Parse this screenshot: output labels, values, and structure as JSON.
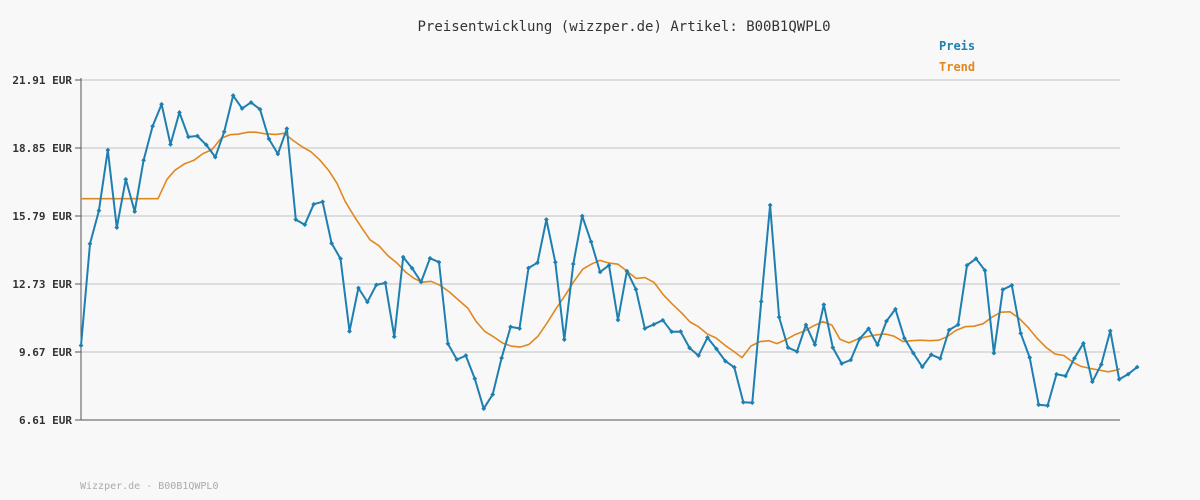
{
  "chart_data": {
    "type": "line",
    "title": "Preisentwicklung (wizzper.de) Artikel: B00B1QWPL0",
    "ylabel": "",
    "xlabel": "",
    "ylim": [
      6.61,
      21.91
    ],
    "yticks": [
      "21.91 EUR",
      "18.85 EUR",
      "15.79 EUR",
      "12.73 EUR",
      "9.67 EUR",
      "6.61 EUR"
    ],
    "ytick_values": [
      21.91,
      18.85,
      15.79,
      12.73,
      9.67,
      6.61
    ],
    "grid": true,
    "legend_position": "top-right",
    "series": [
      {
        "name": "Preis",
        "color": "#1e7fb0",
        "marker": "diamond",
        "values": [
          9.96,
          14.54,
          16.03,
          18.76,
          15.27,
          17.44,
          15.99,
          18.3,
          19.83,
          20.82,
          19.01,
          20.45,
          19.35,
          19.39,
          18.99,
          18.44,
          19.58,
          21.21,
          20.63,
          20.9,
          20.59,
          19.26,
          18.58,
          19.72,
          15.63,
          15.4,
          16.32,
          16.43,
          14.56,
          13.87,
          10.6,
          12.55,
          11.92,
          12.69,
          12.78,
          10.36,
          13.94,
          13.44,
          12.82,
          13.89,
          13.71,
          10.04,
          9.33,
          9.51,
          8.47,
          7.12,
          7.76,
          9.4,
          10.8,
          10.73,
          13.45,
          13.69,
          15.63,
          13.71,
          10.23,
          13.63,
          15.79,
          14.63,
          13.27,
          13.57,
          11.11,
          13.31,
          12.49,
          10.73,
          10.91,
          11.1,
          10.58,
          10.59,
          9.85,
          9.51,
          10.32,
          9.81,
          9.26,
          8.98,
          7.41,
          7.39,
          11.94,
          16.28,
          11.24,
          9.87,
          9.69,
          10.89,
          10.0,
          11.8,
          9.87,
          9.15,
          9.31,
          10.26,
          10.72,
          9.99,
          11.06,
          11.6,
          10.29,
          9.62,
          9.0,
          9.55,
          9.38,
          10.66,
          10.9,
          13.57,
          13.87,
          13.34,
          9.62,
          12.48,
          12.67,
          10.51,
          9.42,
          7.3,
          7.26,
          8.67,
          8.59,
          9.39,
          10.06,
          8.33,
          9.11,
          10.62,
          8.44,
          8.67,
          8.99
        ],
        "x_start": 81,
        "x_step": 8.95
      },
      {
        "name": "Trend",
        "color": "#e08820",
        "points": [
          [
            81,
            16.57
          ],
          [
            158,
            16.57
          ],
          [
            167,
            17.44
          ],
          [
            175,
            17.85
          ],
          [
            185,
            18.15
          ],
          [
            194,
            18.3
          ],
          [
            203,
            18.6
          ],
          [
            212,
            18.78
          ],
          [
            221,
            19.28
          ],
          [
            230,
            19.45
          ],
          [
            238,
            19.47
          ],
          [
            248,
            19.56
          ],
          [
            256,
            19.56
          ],
          [
            265,
            19.49
          ],
          [
            276,
            19.46
          ],
          [
            284,
            19.51
          ],
          [
            293,
            19.19
          ],
          [
            302,
            18.91
          ],
          [
            311,
            18.68
          ],
          [
            320,
            18.3
          ],
          [
            329,
            17.82
          ],
          [
            337,
            17.26
          ],
          [
            345,
            16.46
          ],
          [
            354,
            15.79
          ],
          [
            362,
            15.24
          ],
          [
            370,
            14.72
          ],
          [
            379,
            14.45
          ],
          [
            388,
            14.0
          ],
          [
            397,
            13.67
          ],
          [
            406,
            13.25
          ],
          [
            414,
            12.98
          ],
          [
            422,
            12.81
          ],
          [
            431,
            12.85
          ],
          [
            440,
            12.67
          ],
          [
            449,
            12.39
          ],
          [
            458,
            12.03
          ],
          [
            468,
            11.63
          ],
          [
            476,
            11.05
          ],
          [
            485,
            10.59
          ],
          [
            494,
            10.34
          ],
          [
            503,
            10.06
          ],
          [
            512,
            9.93
          ],
          [
            520,
            9.89
          ],
          [
            529,
            10.01
          ],
          [
            538,
            10.38
          ],
          [
            547,
            10.97
          ],
          [
            556,
            11.62
          ],
          [
            565,
            12.21
          ],
          [
            574,
            12.85
          ],
          [
            583,
            13.41
          ],
          [
            592,
            13.64
          ],
          [
            600,
            13.79
          ],
          [
            609,
            13.67
          ],
          [
            618,
            13.62
          ],
          [
            627,
            13.31
          ],
          [
            636,
            12.98
          ],
          [
            645,
            13.02
          ],
          [
            654,
            12.8
          ],
          [
            663,
            12.26
          ],
          [
            672,
            11.84
          ],
          [
            682,
            11.41
          ],
          [
            690,
            11.02
          ],
          [
            698,
            10.82
          ],
          [
            707,
            10.49
          ],
          [
            716,
            10.3
          ],
          [
            725,
            9.97
          ],
          [
            734,
            9.69
          ],
          [
            742,
            9.42
          ],
          [
            751,
            9.94
          ],
          [
            760,
            10.14
          ],
          [
            769,
            10.18
          ],
          [
            777,
            10.05
          ],
          [
            787,
            10.25
          ],
          [
            796,
            10.47
          ],
          [
            805,
            10.63
          ],
          [
            814,
            10.86
          ],
          [
            823,
            11.04
          ],
          [
            832,
            10.87
          ],
          [
            840,
            10.24
          ],
          [
            849,
            10.08
          ],
          [
            858,
            10.26
          ],
          [
            867,
            10.36
          ],
          [
            876,
            10.44
          ],
          [
            885,
            10.48
          ],
          [
            894,
            10.38
          ],
          [
            903,
            10.14
          ],
          [
            912,
            10.18
          ],
          [
            920,
            10.2
          ],
          [
            930,
            10.18
          ],
          [
            939,
            10.2
          ],
          [
            947,
            10.36
          ],
          [
            956,
            10.64
          ],
          [
            965,
            10.81
          ],
          [
            974,
            10.83
          ],
          [
            983,
            10.94
          ],
          [
            992,
            11.24
          ],
          [
            1001,
            11.46
          ],
          [
            1010,
            11.48
          ],
          [
            1019,
            11.19
          ],
          [
            1028,
            10.78
          ],
          [
            1037,
            10.29
          ],
          [
            1046,
            9.88
          ],
          [
            1055,
            9.58
          ],
          [
            1064,
            9.51
          ],
          [
            1073,
            9.21
          ],
          [
            1081,
            9.02
          ],
          [
            1090,
            8.93
          ],
          [
            1099,
            8.86
          ],
          [
            1108,
            8.78
          ],
          [
            1117,
            8.86
          ],
          [
            1120,
            8.92
          ]
        ]
      }
    ]
  },
  "footer": "Wizzper.de - B00B1QWPL0",
  "colors": {
    "preis": "#1e7fb0",
    "trend": "#e08820",
    "grid": "#dddddd",
    "axis": "#555555"
  }
}
